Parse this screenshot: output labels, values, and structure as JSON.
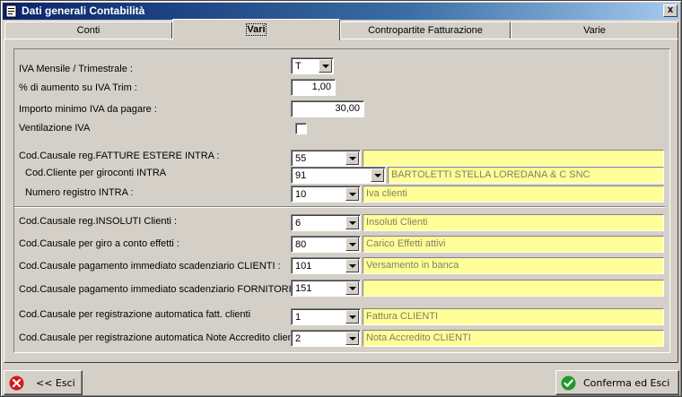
{
  "window": {
    "title": "Dati generali Contabilità",
    "close_label": "x"
  },
  "tabs": [
    {
      "label": "Conti"
    },
    {
      "label": "Vari"
    },
    {
      "label": "Contropartite Fatturazione"
    },
    {
      "label": "Varie"
    }
  ],
  "iva": {
    "mensile_label": "IVA Mensile / Trimestrale :",
    "mensile_value": "T",
    "aumento_label": "% di aumento su IVA Trim :",
    "aumento_value": "1,00",
    "importo_label": "Importo minimo IVA da pagare :",
    "importo_value": "30,00",
    "ventilazione_label": "Ventilazione IVA",
    "ventilazione_checked": false
  },
  "intra": {
    "causale_label": "Cod.Causale reg.FATTURE ESTERE INTRA :",
    "causale_value": "55",
    "causale_desc": "",
    "cliente_label": "Cod.Cliente per giroconti INTRA",
    "cliente_value": "91",
    "cliente_desc": "BARTOLETTI STELLA LOREDANA & C SNC",
    "registro_label": "Numero registro INTRA :",
    "registro_value": "10",
    "registro_desc": "Iva clienti"
  },
  "causali": [
    {
      "label": "Cod.Causale reg.INSOLUTI Clienti :",
      "value": "6",
      "desc": "Insoluti Clienti"
    },
    {
      "label": "Cod.Causale per giro a conto effetti :",
      "value": "80",
      "desc": "Carico Effetti attivi"
    },
    {
      "label": "Cod.Causale pagamento immediato scadenziario CLIENTI :",
      "value": "101",
      "desc": "Versamento in banca"
    },
    {
      "label": "Cod.Causale pagamento immediato scadenziario FORNITORI :",
      "value": "151",
      "desc": ""
    },
    {
      "label": "Cod.Causale per registrazione automatica fatt. clienti",
      "value": "1",
      "desc": "Fattura CLIENTI"
    },
    {
      "label": "Cod.Causale per registrazione automatica Note Accredito clienti",
      "value": "2",
      "desc": "Nota Accredito CLIENTI"
    }
  ],
  "buttons": {
    "esci_label": "<< Esci",
    "conferma_label": "Conferma ed Esci"
  },
  "colors": {
    "titlebar": "#0a246a",
    "highlight": "#ffff99",
    "face": "#d4d0c8"
  }
}
